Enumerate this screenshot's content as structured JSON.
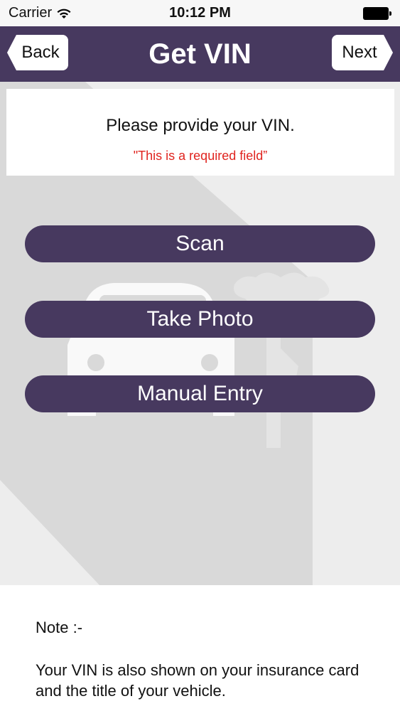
{
  "status_bar": {
    "carrier": "Carrier",
    "time": "10:12 PM",
    "wifi_icon": "wifi-icon",
    "battery_icon": "battery-icon"
  },
  "nav": {
    "title": "Get VIN",
    "back_label": "Back",
    "next_label": "Next"
  },
  "prompt": {
    "title": "Please provide your VIN.",
    "required": "\"This is a required field”"
  },
  "actions": {
    "scan_label": "Scan",
    "photo_label": "Take Photo",
    "manual_label": "Manual Entry"
  },
  "note": {
    "label": "Note :-",
    "text": "Your VIN is also shown on your insurance card and the title of your vehicle."
  },
  "colors": {
    "primary": "#47395f",
    "required_text": "#e0241f",
    "background": "#ededed"
  },
  "decorations": [
    "car-watermark-icon",
    "key-watermark-icon"
  ]
}
